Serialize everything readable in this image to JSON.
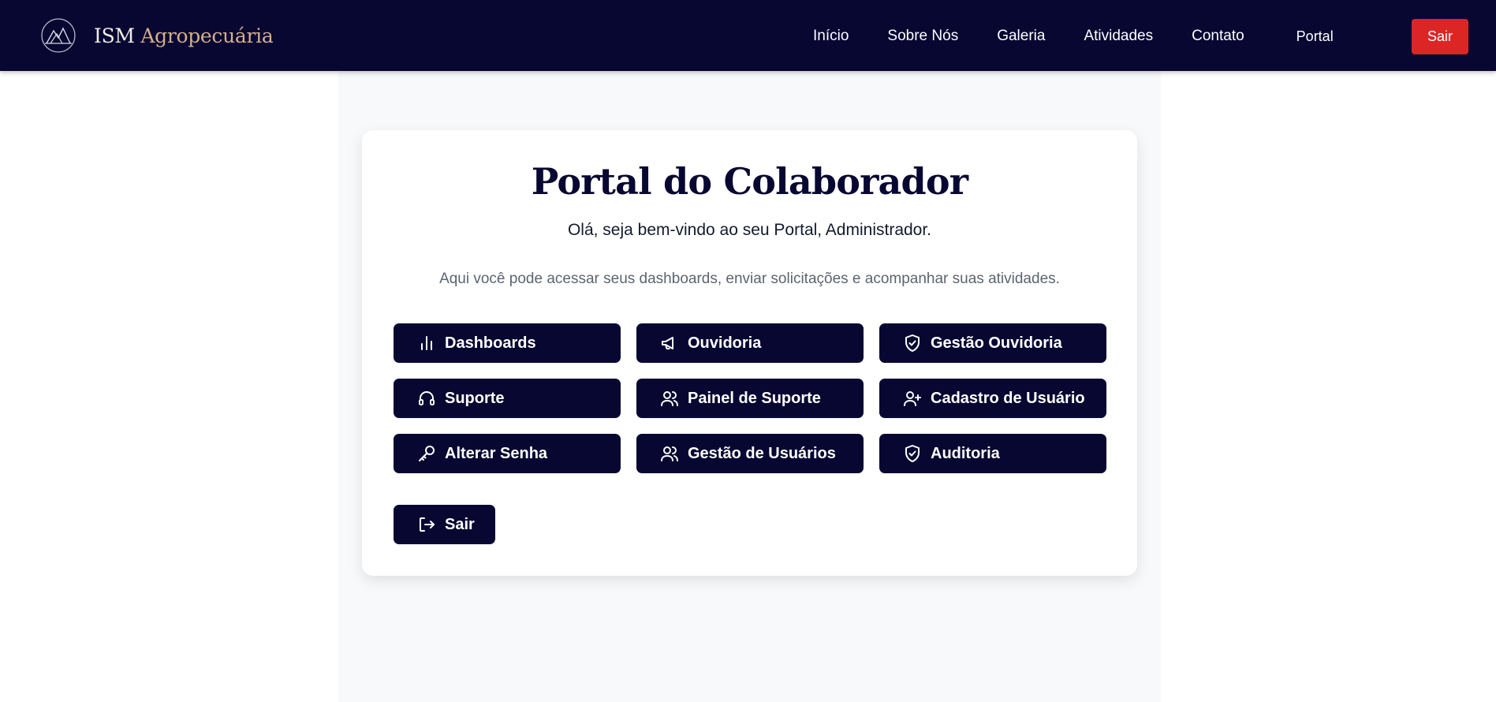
{
  "header": {
    "brand_prefix": "ISM",
    "brand_suffix": "Agropecuária",
    "nav": [
      "Início",
      "Sobre Nós",
      "Galeria",
      "Atividades",
      "Contato"
    ],
    "portal_label": "Portal",
    "logout_label": "Sair"
  },
  "card": {
    "title": "Portal do Colaborador",
    "greeting": "Olá, seja bem-vindo ao seu Portal, Administrador.",
    "description": "Aqui você pode acessar seus dashboards, enviar solicitações e acompanhar suas atividades.",
    "buttons": [
      {
        "label": "Dashboards",
        "icon": "bar-chart-icon"
      },
      {
        "label": "Ouvidoria",
        "icon": "megaphone-icon"
      },
      {
        "label": "Gestão Ouvidoria",
        "icon": "shield-check-icon"
      },
      {
        "label": "Suporte",
        "icon": "headset-icon"
      },
      {
        "label": "Painel de Suporte",
        "icon": "users-icon"
      },
      {
        "label": "Cadastro de Usuário",
        "icon": "user-plus-icon"
      },
      {
        "label": "Alterar Senha",
        "icon": "key-icon"
      },
      {
        "label": "Gestão de Usuários",
        "icon": "users-icon"
      },
      {
        "label": "Auditoria",
        "icon": "shield-check-icon"
      }
    ],
    "exit_label": "Sair",
    "exit_icon": "log-out-icon"
  },
  "colors": {
    "navy": "#070732",
    "accent_gold": "#d6ae8d",
    "danger_red": "#dc2626",
    "panel_bg": "#f8f9fb"
  }
}
